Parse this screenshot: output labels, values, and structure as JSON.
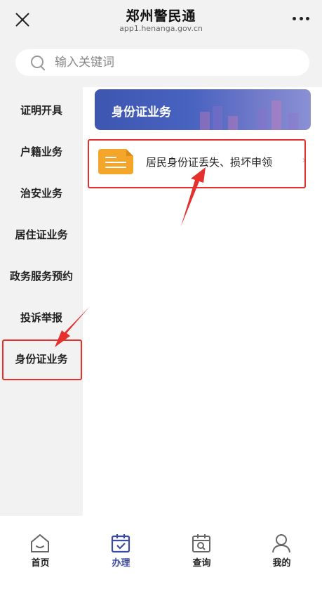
{
  "header": {
    "title": "郑州警民通",
    "subtitle": "app1.henanga.gov.cn"
  },
  "search": {
    "placeholder": "输入关键词"
  },
  "sidebar": {
    "items": [
      {
        "label": "证明开具"
      },
      {
        "label": "户籍业务"
      },
      {
        "label": "治安业务"
      },
      {
        "label": "居住证业务"
      },
      {
        "label": "政务服务预约"
      },
      {
        "label": "投诉举报"
      },
      {
        "label": "身份证业务"
      }
    ],
    "selected": "身份证业务"
  },
  "main": {
    "banner_title": "身份证业务",
    "services": [
      {
        "label": "居民身份证丢失、损坏申领",
        "icon": "document-icon"
      }
    ]
  },
  "tabbar": {
    "tabs": [
      {
        "label": "首页",
        "icon": "home-icon"
      },
      {
        "label": "办理",
        "icon": "calendar-check-icon"
      },
      {
        "label": "查询",
        "icon": "calendar-search-icon"
      },
      {
        "label": "我的",
        "icon": "user-icon"
      }
    ],
    "active": "办理"
  },
  "colors": {
    "accent": "#3c4aa0",
    "highlight": "#e5302e",
    "doc_icon": "#f4a62a"
  }
}
